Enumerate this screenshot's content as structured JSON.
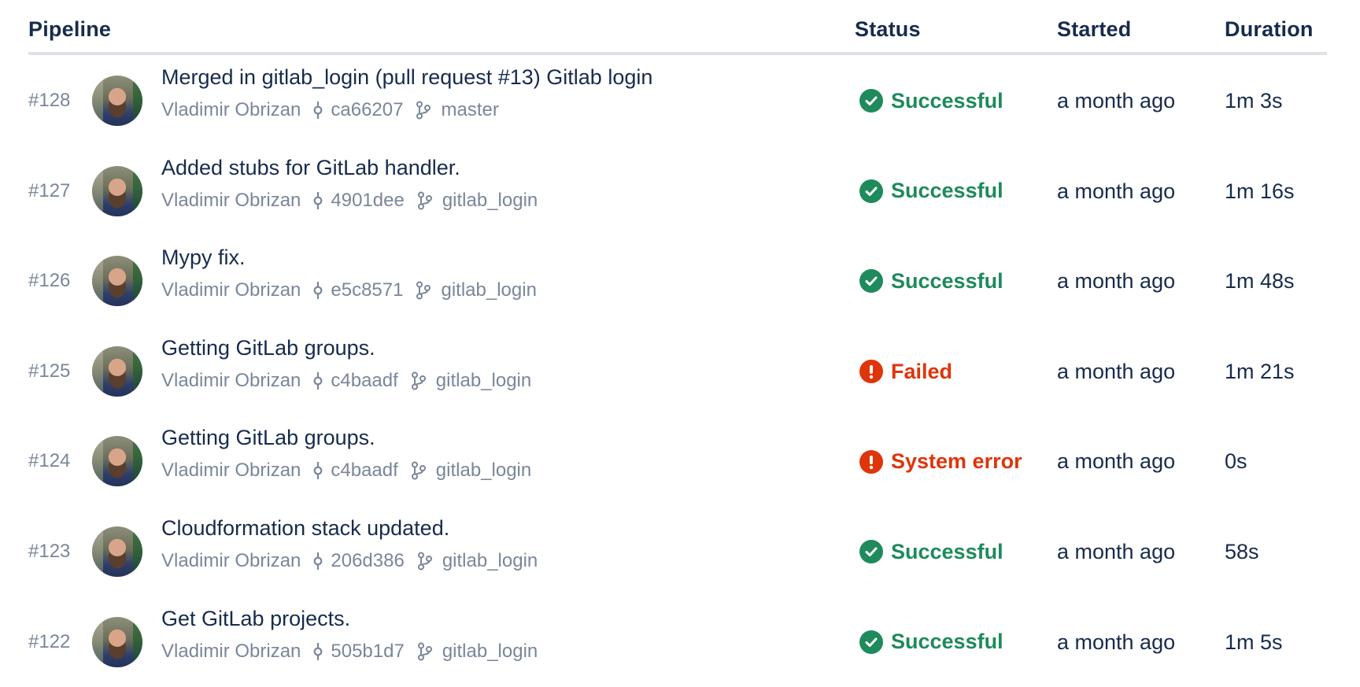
{
  "header": {
    "pipeline": "Pipeline",
    "status": "Status",
    "started": "Started",
    "duration": "Duration"
  },
  "colors": {
    "success": "#1f8a5b",
    "failure": "#de350b",
    "text": "#172b4d",
    "muted": "#7a869a"
  },
  "icons": {
    "commit": "commit-icon",
    "branch": "branch-icon",
    "success": "check-circle-icon",
    "failure": "exclamation-circle-icon"
  },
  "pipelines": [
    {
      "number": "#128",
      "title": "Merged in gitlab_login (pull request #13) Gitlab login",
      "author": "Vladimir Obrizan",
      "commit": "ca66207",
      "branch": "master",
      "status": "Successful",
      "status_type": "success",
      "started": "a month ago",
      "duration": "1m 3s"
    },
    {
      "number": "#127",
      "title": "Added stubs for GitLab handler.",
      "author": "Vladimir Obrizan",
      "commit": "4901dee",
      "branch": "gitlab_login",
      "status": "Successful",
      "status_type": "success",
      "started": "a month ago",
      "duration": "1m 16s"
    },
    {
      "number": "#126",
      "title": "Mypy fix.",
      "author": "Vladimir Obrizan",
      "commit": "e5c8571",
      "branch": "gitlab_login",
      "status": "Successful",
      "status_type": "success",
      "started": "a month ago",
      "duration": "1m 48s"
    },
    {
      "number": "#125",
      "title": "Getting GitLab groups.",
      "author": "Vladimir Obrizan",
      "commit": "c4baadf",
      "branch": "gitlab_login",
      "status": "Failed",
      "status_type": "failure",
      "started": "a month ago",
      "duration": "1m 21s"
    },
    {
      "number": "#124",
      "title": "Getting GitLab groups.",
      "author": "Vladimir Obrizan",
      "commit": "c4baadf",
      "branch": "gitlab_login",
      "status": "System error",
      "status_type": "failure",
      "started": "a month ago",
      "duration": "0s"
    },
    {
      "number": "#123",
      "title": "Cloudformation stack updated.",
      "author": "Vladimir Obrizan",
      "commit": "206d386",
      "branch": "gitlab_login",
      "status": "Successful",
      "status_type": "success",
      "started": "a month ago",
      "duration": "58s"
    },
    {
      "number": "#122",
      "title": "Get GitLab projects.",
      "author": "Vladimir Obrizan",
      "commit": "505b1d7",
      "branch": "gitlab_login",
      "status": "Successful",
      "status_type": "success",
      "started": "a month ago",
      "duration": "1m 5s"
    }
  ]
}
